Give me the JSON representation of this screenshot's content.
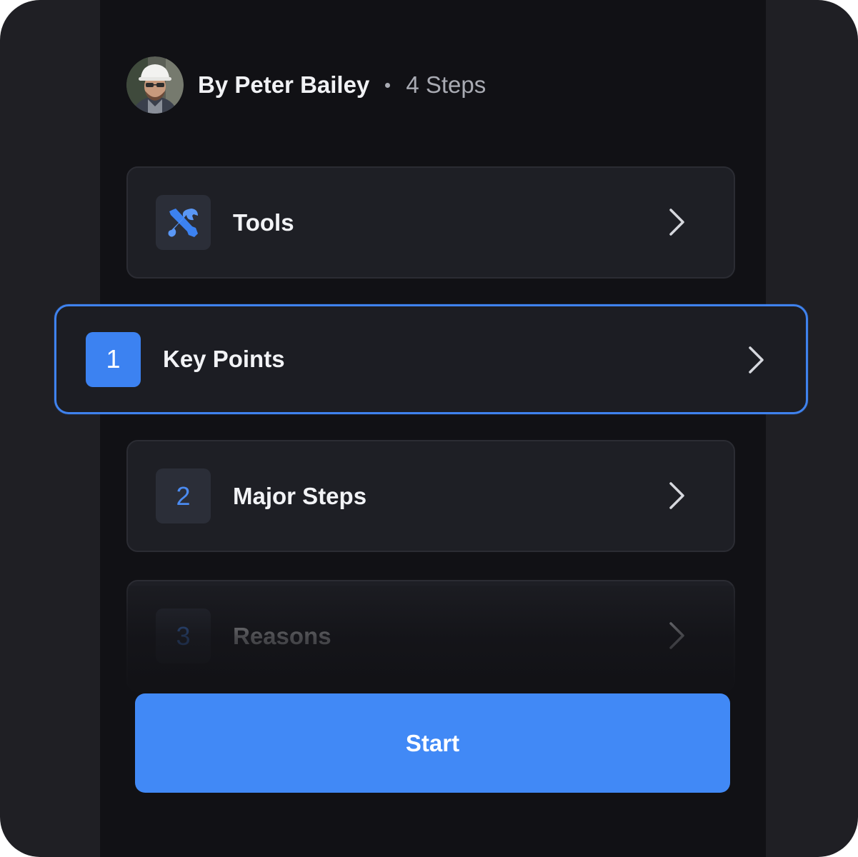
{
  "author": {
    "name": "By Peter Bailey",
    "steps_count": "4 Steps"
  },
  "guide_items": [
    {
      "badge_icon": "tools-icon",
      "label": "Tools"
    },
    {
      "badge": "1",
      "label": "Key Points",
      "selected": true
    },
    {
      "badge": "2",
      "label": "Major Steps"
    },
    {
      "badge": "3",
      "label": "Reasons"
    }
  ],
  "start_button": {
    "label": "Start"
  },
  "colors": {
    "accent": "#4189f6",
    "background": "#111115",
    "card": "#1e1f25",
    "frame": "#1f1f24"
  }
}
